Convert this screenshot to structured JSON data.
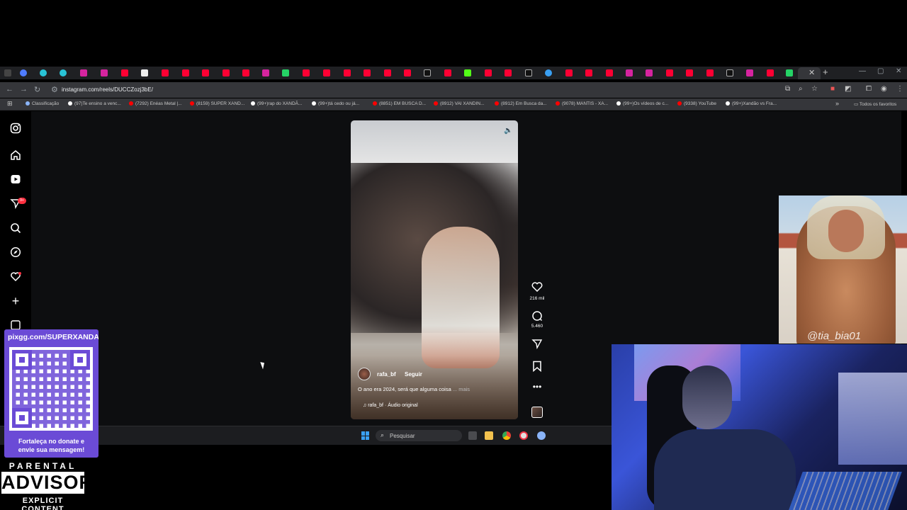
{
  "browser": {
    "url": "instagram.com/reels/DUCCZozj3bE/",
    "bookmarks": [
      {
        "label": "Classificação",
        "color": "#8ab4f8"
      },
      {
        "label": "(97)Te ensino a venc...",
        "color": "#ffffff"
      },
      {
        "label": "(7292) Enéas Metal |...",
        "color": "#ff0000"
      },
      {
        "label": "(8159) SUPER XAND...",
        "color": "#ff0000"
      },
      {
        "label": "(99+)rap do XANDÃ...",
        "color": "#ffffff"
      },
      {
        "label": "(99+)tá cedo ou já...",
        "color": "#ffffff"
      },
      {
        "label": "(8851) EM BUSCA D...",
        "color": "#ff0000"
      },
      {
        "label": "(8912) VAI XANDIN...",
        "color": "#ff0000"
      },
      {
        "label": "(8912) Em Busca da...",
        "color": "#ff0000"
      },
      {
        "label": "(9078) MANTIS - XA...",
        "color": "#ff0000"
      },
      {
        "label": "(99+)Os vídeos de c...",
        "color": "#ffffff"
      },
      {
        "label": "(9338) YouTube",
        "color": "#ff0000"
      },
      {
        "label": "(99+)Xandão vs Fra...",
        "color": "#ffffff"
      }
    ],
    "all_favorites": "Todos os favoritos"
  },
  "instagram": {
    "nav_icons": [
      "instagram-logo-icon",
      "home-icon",
      "reels-icon",
      "messages-icon",
      "search-icon",
      "explore-icon",
      "notifications-icon",
      "create-icon",
      "dashboard-icon"
    ],
    "notif_badge": "9+",
    "reel": {
      "username": "rafa_bf",
      "follow_label": "Seguir",
      "caption": "O ano era 2024, será que alguma coisa",
      "more": "... mais",
      "audio": "rafa_bf · Áudio original"
    },
    "actions": {
      "likes": "216 mil",
      "comments": "5.460"
    }
  },
  "taskbar": {
    "search_placeholder": "Pesquisar"
  },
  "overlay": {
    "qr_url": "pixgg.com/SUPERXANDAO",
    "qr_message_1": "Fortaleça no donate e",
    "qr_message_2": "envie sua mensagem!",
    "advisory_top": "PARENTAL",
    "advisory_mid": "ADVISORY",
    "advisory_bottom": "EXPLICIT CONTENT",
    "meme_tag": "@tia_bia01"
  }
}
